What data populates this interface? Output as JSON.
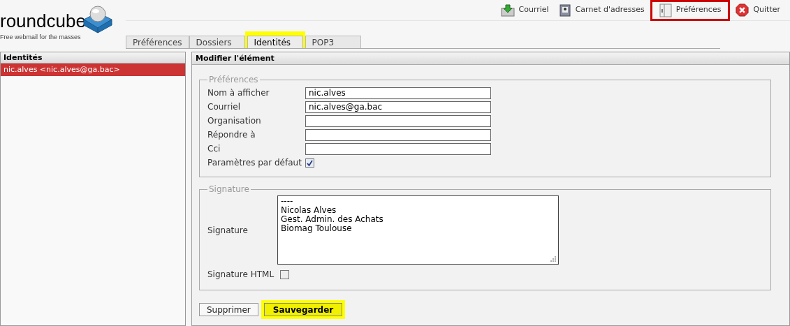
{
  "logo": {
    "name": "roundcube",
    "tagline": "Free webmail for the masses"
  },
  "nav": [
    {
      "label": "Courriel",
      "kind": "mail",
      "highlighted": false
    },
    {
      "label": "Carnet d'adresses",
      "kind": "book",
      "highlighted": false
    },
    {
      "label": "Préférences",
      "kind": "prefs",
      "highlighted": true
    },
    {
      "label": "Quitter",
      "kind": "quit",
      "highlighted": false
    }
  ],
  "tabs": [
    {
      "label": "Préférences",
      "selected": false,
      "highlighted": false
    },
    {
      "label": "Dossiers",
      "selected": false,
      "highlighted": false
    },
    {
      "label": "Identités",
      "selected": true,
      "highlighted": true
    },
    {
      "label": "POP3",
      "selected": false,
      "highlighted": false
    }
  ],
  "identities": {
    "title": "Identités",
    "items": [
      {
        "label": "nic.alves <nic.alves@ga.bac>",
        "selected": true
      }
    ]
  },
  "editor": {
    "title": "Modifier l'élément",
    "preferences": {
      "legend": "Préférences",
      "fields": [
        {
          "kind": "text",
          "label": "Nom à afficher",
          "value": "nic.alves"
        },
        {
          "kind": "text",
          "label": "Courriel",
          "value": "nic.alves@ga.bac"
        },
        {
          "kind": "text",
          "label": "Organisation"
        },
        {
          "kind": "text",
          "label": "Répondre à"
        },
        {
          "kind": "text",
          "label": "Cci"
        },
        {
          "kind": "checkbox",
          "label": "Paramètres par défaut",
          "checked": true
        }
      ]
    },
    "signature": {
      "legend": "Signature",
      "label": "Signature",
      "lines": [
        "----",
        "Nicolas Alves",
        "Gest. Admin. des Achats",
        "Biomag Toulouse"
      ],
      "html_label": "Signature HTML",
      "html_checked": false
    },
    "buttons": [
      {
        "label": "Supprimer",
        "primary": false,
        "highlighted": false
      },
      {
        "label": "Sauvegarder",
        "primary": true,
        "highlighted": true
      }
    ]
  }
}
